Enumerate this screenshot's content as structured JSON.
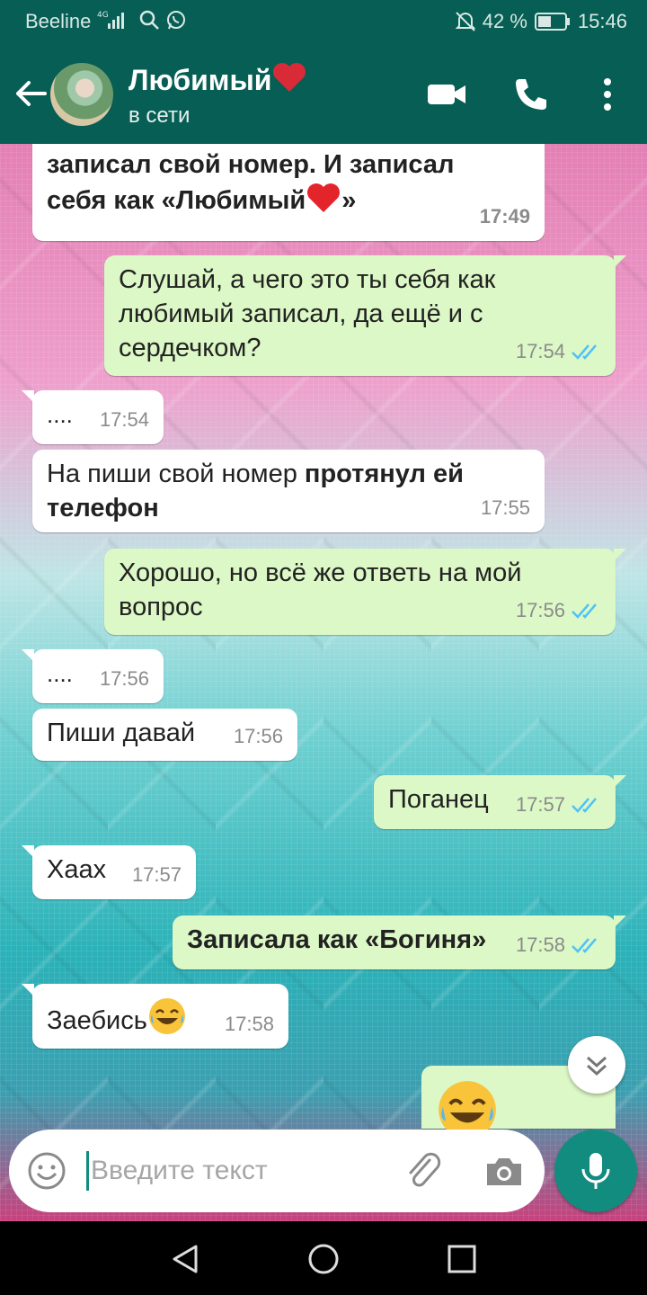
{
  "status_bar": {
    "carrier": "Beeline",
    "battery": "42 %",
    "time": "15:46"
  },
  "header": {
    "contact_name": "Любимый",
    "contact_status": "в сети"
  },
  "messages": [
    {
      "dir": "in",
      "line1": "записал свой номер. И записал",
      "line2": "себя как «Любимый",
      "line2_end": "»",
      "time": "17:49"
    },
    {
      "dir": "out",
      "line1": "Слушай, а чего это ты себя как",
      "line2": "любимый записал, да ещё и с",
      "line3": "сердечком?",
      "time": "17:54"
    },
    {
      "dir": "in",
      "text": "....",
      "time": "17:54"
    },
    {
      "dir": "in",
      "text_plain": "На пиши свой номер ",
      "text_bold": "протянул ей",
      "text_bold2": "телефон",
      "time": "17:55"
    },
    {
      "dir": "out",
      "line1": "Хорошо, но всё же ответь на мой",
      "line2": "вопрос",
      "time": "17:56"
    },
    {
      "dir": "in",
      "text": "....",
      "time": "17:56"
    },
    {
      "dir": "in",
      "text": "Пиши давай",
      "time": "17:56"
    },
    {
      "dir": "out",
      "text": "Поганец",
      "time": "17:57"
    },
    {
      "dir": "in",
      "text": "Хаах",
      "time": "17:57"
    },
    {
      "dir": "out",
      "text": "Записала как «Богиня»",
      "time": "17:58"
    },
    {
      "dir": "in",
      "text": "Заебись",
      "time": "17:58"
    }
  ],
  "input": {
    "placeholder": "Введите текст"
  },
  "colors": {
    "header": "#075e54",
    "accent": "#128c7e",
    "outgoing_bubble": "#dcf8c6",
    "incoming_bubble": "#ffffff",
    "read_ticks": "#4fc3f7"
  },
  "icons": [
    "back-arrow-icon",
    "video-call-icon",
    "phone-icon",
    "more-vert-icon",
    "emoji-icon",
    "attach-icon",
    "camera-icon",
    "mic-icon",
    "chevron-down-icon",
    "nav-back-icon",
    "nav-home-icon",
    "nav-recents-icon"
  ]
}
